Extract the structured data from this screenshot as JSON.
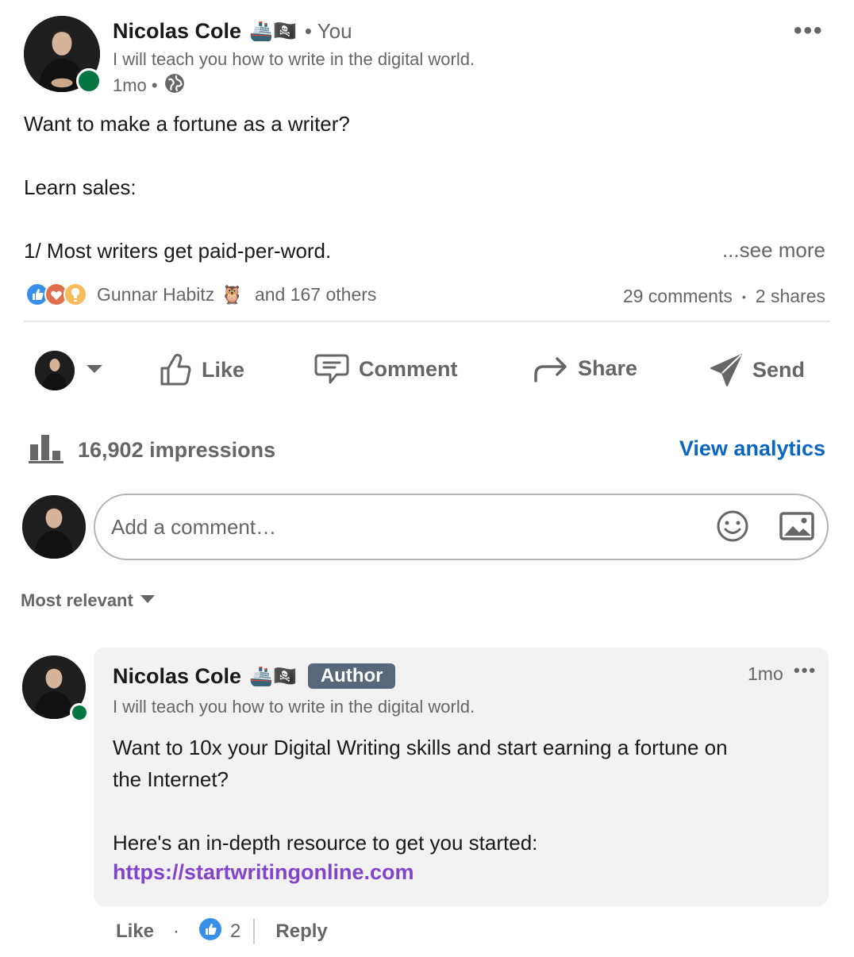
{
  "post": {
    "author": {
      "name": "Nicolas Cole",
      "emojis": "🚢🏴‍☠️",
      "relation": "• You",
      "headline": "I will teach you how to write in the digital world.",
      "time": "1mo •",
      "visibility_icon": "globe-icon"
    },
    "menu_label": "•••",
    "body": {
      "line1": "Want to make a fortune as a writer?",
      "line2": "Learn sales:",
      "line3": "1/ Most writers get paid-per-word.",
      "see_more": "...see more"
    },
    "social": {
      "reactor": "Gunnar Habitz",
      "reactor_emoji": "🦉",
      "others": "and 167 others",
      "comments": "29 comments",
      "separator": "•",
      "shares": "2 shares",
      "reaction_icons": [
        "like-icon",
        "love-icon",
        "insightful-icon"
      ]
    },
    "actions": {
      "like": "Like",
      "comment": "Comment",
      "share": "Share",
      "send": "Send"
    },
    "analytics": {
      "impressions": "16,902 impressions",
      "view_analytics": "View analytics"
    },
    "comment_input": {
      "placeholder": "Add a comment…"
    },
    "sort": {
      "label": "Most relevant"
    }
  },
  "comment": {
    "author": {
      "name": "Nicolas Cole",
      "emojis": "🚢🏴‍☠️",
      "badge": "Author",
      "headline": "I will teach you how to write in the digital world."
    },
    "time": "1mo",
    "menu_label": "•••",
    "text_line1": "Want to 10x your Digital Writing skills and start earning a fortune on",
    "text_line2": "the Internet?",
    "text_line3": "Here's an in-depth resource to get you started:",
    "link": "https://startwritingonline.com",
    "actions": {
      "like": "Like",
      "separator": "·",
      "like_count": "2",
      "reply": "Reply"
    }
  },
  "colors": {
    "accent_blue": "#0a66c2",
    "presence_green": "#057642",
    "link_purple": "#8344cc",
    "author_badge": "#56687a"
  }
}
